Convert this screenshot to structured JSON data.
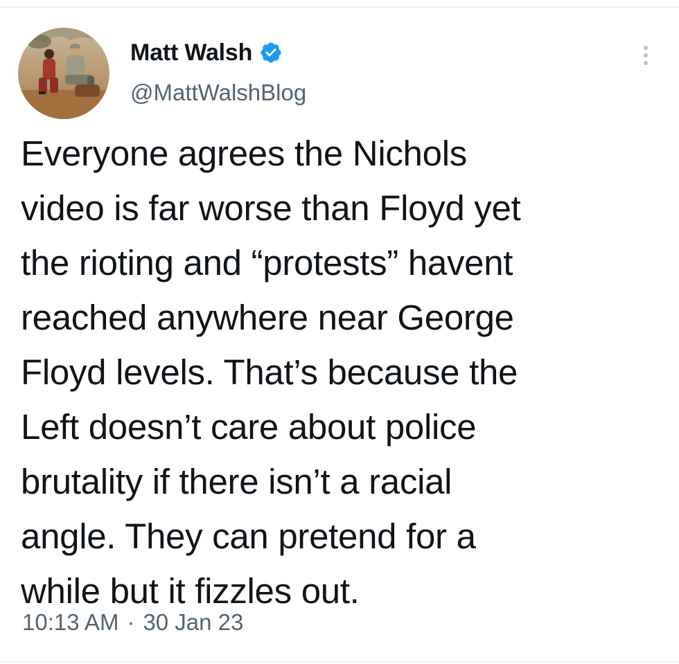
{
  "author": {
    "display_name": "Matt Walsh",
    "handle": "@MattWalshBlog",
    "verified": true
  },
  "tweet": {
    "text_lines": [
      "Everyone agrees the Nichols",
      "video is far worse than Floyd yet",
      "the rioting and “protests” havent",
      "reached anywhere near George",
      "Floyd levels. That’s because the",
      "Left doesn’t care about police",
      "brutality if there isn’t a racial",
      "angle. They can pretend for a",
      "while but it fizzles out."
    ],
    "time": "10:13 AM",
    "separator": "·",
    "date": "30 Jan 23"
  },
  "icons": {
    "verified": "verified-badge-icon",
    "more": "more-options-icon"
  },
  "colors": {
    "text_primary": "#0f1419",
    "text_secondary": "#536471",
    "verified_blue": "#1d9bf0",
    "divider": "#e6e9eb"
  }
}
